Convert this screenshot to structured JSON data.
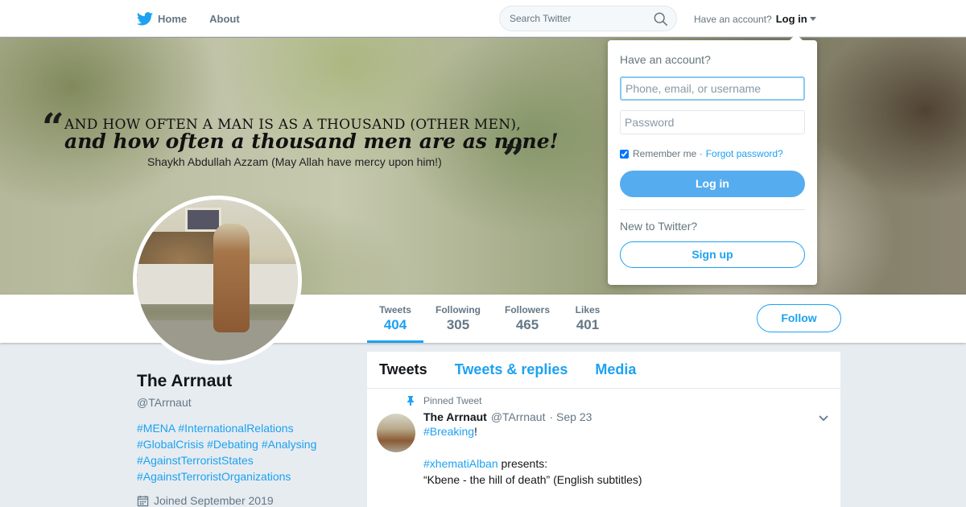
{
  "nav": {
    "home_label": "Home",
    "about_label": "About",
    "search_placeholder": "Search Twitter",
    "account_prompt": "Have an account?",
    "login_label": "Log in"
  },
  "banner": {
    "quote_line1": "And how often a man is as a thousand (other men),",
    "quote_line2": "and how often a thousand men are as none!",
    "attribution": "Shaykh Abdullah Azzam (May Allah have mercy upon him!)"
  },
  "stats": [
    {
      "label": "Tweets",
      "value": "404"
    },
    {
      "label": "Following",
      "value": "305"
    },
    {
      "label": "Followers",
      "value": "465"
    },
    {
      "label": "Likes",
      "value": "401"
    }
  ],
  "follow_label": "Follow",
  "profile": {
    "name": "The Arrnaut",
    "handle": "@TArrnaut",
    "bio_lines": [
      [
        "#MENA",
        "#InternationalRelations"
      ],
      [
        "#GlobalCrisis",
        "#Debating",
        "#Analysing"
      ],
      [
        "#AgainstTerroristStates"
      ],
      [
        "#AgainstTerroristOrganizations"
      ]
    ],
    "joined": "Joined September 2019"
  },
  "timeline": {
    "tabs": [
      "Tweets",
      "Tweets & replies",
      "Media"
    ],
    "pinned_label": "Pinned Tweet",
    "tweet": {
      "name": "The Arrnaut",
      "handle": "@TArrnaut",
      "date": "· Sep 23",
      "hashtag1": "#Breaking",
      "hashtag1_suffix": "!",
      "hashtag2": "#xhematiAlban",
      "hashtag2_suffix": " presents:",
      "line3": "“Kbene - the hill of death” (English subtitles)"
    }
  },
  "login_dropdown": {
    "title": "Have an account?",
    "username_placeholder": "Phone, email, or username",
    "password_placeholder": "Password",
    "remember_label": "Remember me ·",
    "forgot_label": "Forgot password?",
    "login_button": "Log in",
    "new_prompt": "New to Twitter?",
    "signup_button": "Sign up"
  },
  "colors": {
    "accent": "#1da1f2",
    "login_button_bg": "#55acee",
    "page_bg": "#e6ecf0"
  }
}
